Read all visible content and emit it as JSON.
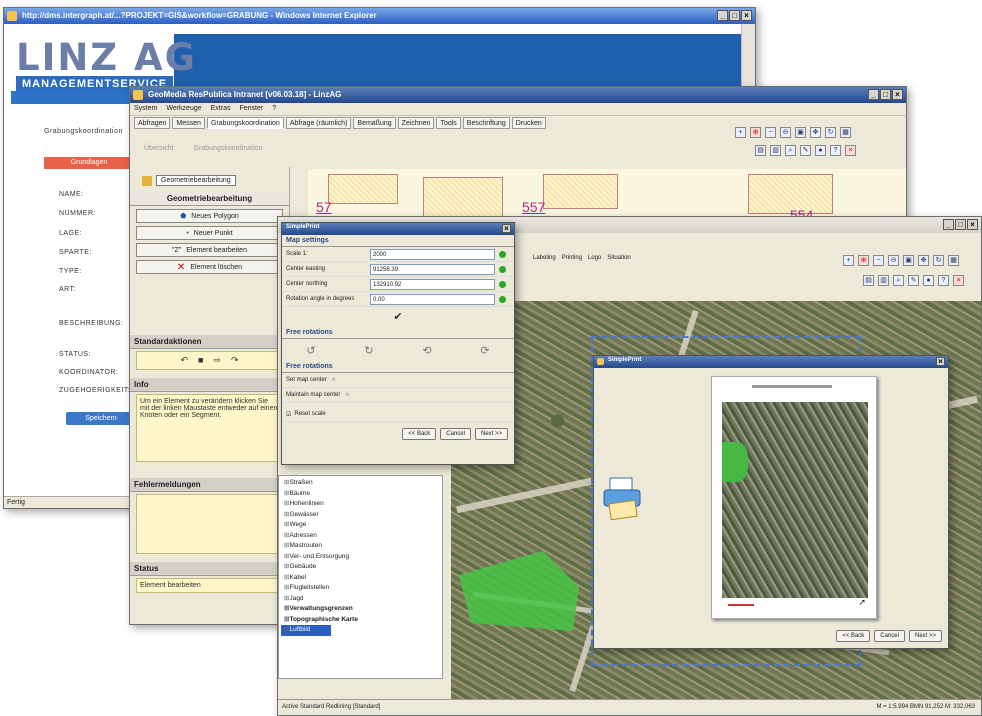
{
  "w1": {
    "title": "http://dms.intergraph.at/...?PROJEKT=GIS&workflow=GRABUNG - Windows Internet Explorer",
    "logo": "LINZ AG",
    "logo_sub": "MANAGEMENTSERVICE",
    "left_label": "Grabungskoordination",
    "tab_button": "Grundlagen",
    "fields": [
      "NAME:",
      "NUMMER:",
      "LAGE:",
      "SPARTE:",
      "TYPE:",
      "ART:",
      "BESCHREIBUNG:",
      "STATUS:",
      "KOORDINATOR:",
      "ZUGEHOERIGKEIT:"
    ],
    "save_button": "Speichern",
    "status": "Fertig"
  },
  "w2": {
    "title": "GeoMedia ResPublica Intranet [v06.03.18] - LinzAG",
    "menu": [
      "System",
      "Werkzeuge",
      "Extras",
      "Fenster",
      "?"
    ],
    "tabs": [
      "Abfragen",
      "Messen",
      "Grabungskoordination",
      "Abfrage (räumlich)",
      "Bemaßung",
      "Zeichnen",
      "Tools",
      "Beschriftung",
      "Drucken"
    ],
    "subtabs": [
      "Übersicht",
      "Grabungskoordination"
    ],
    "dropdown": "Geometriebearbeitung",
    "section_geom": "Geometriebearbeitung",
    "buttons": [
      "Neues Polygon",
      "Neuer Punkt",
      "Element bearbeiten",
      "Element löschen"
    ],
    "section_std": "Standardaktionen",
    "section_info": "Info",
    "info_text": "Um ein Element zu verändern klicken Sie mit der linken Maustaste entweder auf einen Knoten oder ein Segment.",
    "section_fehler": "Fehlermeldungen",
    "section_status": "Status",
    "status_text": "Element bearbeiten",
    "parcels": [
      "57",
      "557",
      "554"
    ]
  },
  "w3": {
    "menu": [
      "Labeling",
      "Printing",
      "Logo",
      "Situation"
    ],
    "layers": [
      "Straßen",
      "Bäume",
      "Hohenlinien",
      "Gewässer",
      "Wege",
      "Adressen",
      "Mastrouten",
      "Ver- und Entsorgung",
      "Gebäude",
      "Kabel",
      "Flugleitstellen",
      "Jagd"
    ],
    "layers_bold": [
      "Verwaltungsgrenzen",
      "Topographische Karte"
    ],
    "layer_selected": "Luftbild",
    "statusbar": "Active Standard Redlining [Standard]",
    "coords": "M = 1:5.994 BMN 91,252 M: 332,063"
  },
  "w4": {
    "title": "SimplePrint",
    "group1": "Map settings",
    "rows": [
      {
        "label": "Scale 1:",
        "value": "2000"
      },
      {
        "label": "Center easting",
        "value": "91256.39"
      },
      {
        "label": "Center northing",
        "value": "132910.92"
      },
      {
        "label": "Rotation angle in degrees",
        "value": "0.00"
      }
    ],
    "group2": "Free rotations",
    "group3": "Free rotations",
    "opt1": "Set map center",
    "opt2": "Maintain map center",
    "chk": "Reset scale",
    "btn_back": "<< Back",
    "btn_cancel": "Cancel",
    "btn_next": "Next >>"
  },
  "w5": {
    "title": "SimplePrint",
    "btn_back": "<< Back",
    "btn_cancel": "Cancel",
    "btn_next": "Next >>"
  }
}
